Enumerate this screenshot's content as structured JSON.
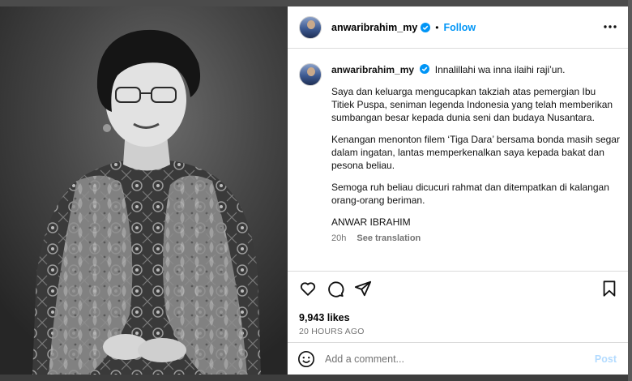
{
  "post": {
    "username": "anwaribrahim_my",
    "follow_label": "Follow",
    "separator": "•",
    "caption": {
      "first_line": "Innalillahi wa inna ilaihi raji’un.",
      "paragraphs": [
        "Saya dan keluarga mengucapkan takziah atas pemergian Ibu Titiek Puspa, seniman legenda Indonesia yang telah memberikan sumbangan besar kepada dunia seni dan budaya Nusantara.",
        "Kenangan menonton filem ‘Tiga Dara’ bersama bonda masih segar dalam ingatan, lantas memperkenalkan saya kepada bakat dan pesona beliau.",
        "Semoga ruh beliau dicucuri rahmat dan ditempatkan di kalangan orang-orang beriman.",
        "ANWAR IBRAHIM"
      ],
      "time": "20h",
      "see_translation": "See translation"
    },
    "likes": "9,943 likes",
    "time_ago": "20 HOURS AGO",
    "comment_placeholder": "Add a comment...",
    "post_label": "Post"
  },
  "icons": {
    "verified": "verified-badge-icon",
    "more": "more-options-icon",
    "like": "heart-icon",
    "comment": "comment-icon",
    "share": "share-icon",
    "save": "bookmark-icon",
    "emoji": "emoji-icon"
  },
  "colors": {
    "link": "#0095f6",
    "muted": "#737373",
    "post_disabled": "#b3dbff"
  }
}
